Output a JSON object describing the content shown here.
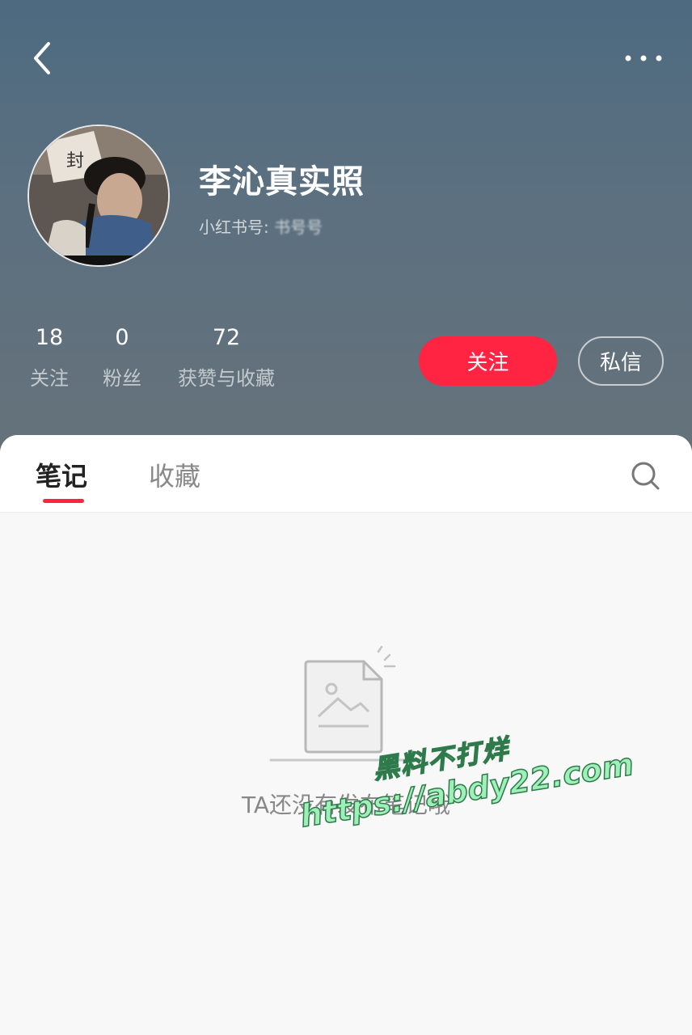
{
  "profile": {
    "name": "李沁真实照",
    "id_label": "小红书号: ",
    "id_value": "书号号"
  },
  "stats": [
    {
      "count": "18",
      "label": "关注"
    },
    {
      "count": "0",
      "label": "粉丝"
    },
    {
      "count": "72",
      "label": "获赞与收藏"
    }
  ],
  "actions": {
    "follow": "关注",
    "message": "私信"
  },
  "tabs": [
    {
      "label": "笔记",
      "active": true
    },
    {
      "label": "收藏",
      "active": false
    }
  ],
  "empty_state": {
    "text": "TA还没有发布笔记哦"
  },
  "watermark": {
    "line1": "黑料不打烊",
    "line2": "https://abdy22.com"
  },
  "colors": {
    "accent": "#ff2442",
    "header_bg": "#586f80"
  },
  "icons": {
    "back": "chevron-left-icon",
    "more": "more-dots-icon",
    "search": "search-icon"
  }
}
